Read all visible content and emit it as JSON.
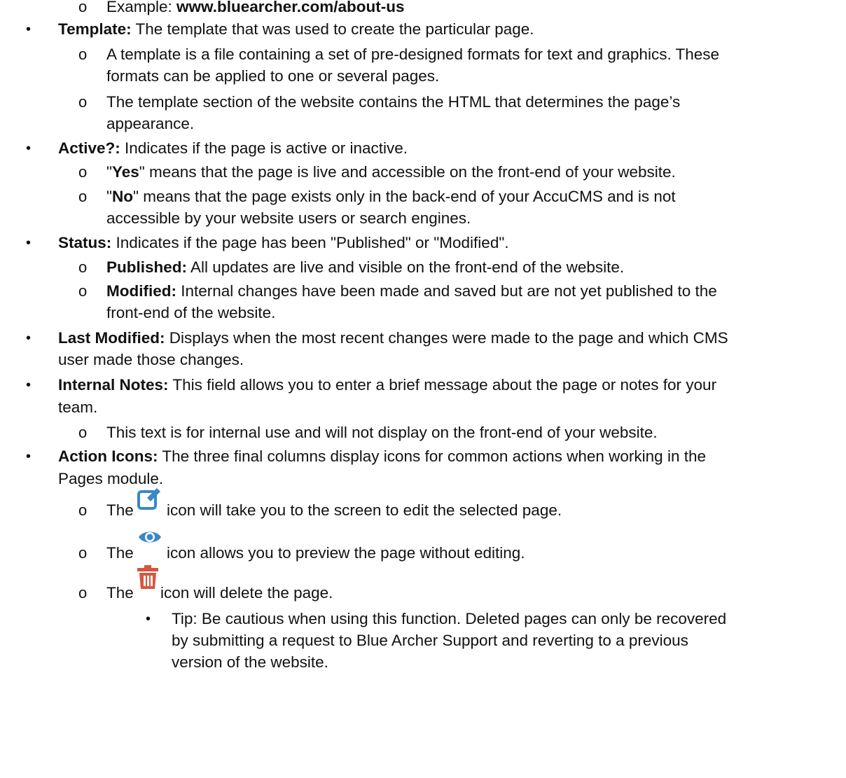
{
  "example": {
    "label": "Example: ",
    "url": "www.bluearcher.com/about-us"
  },
  "template": {
    "term": "Template:",
    "desc": " The template that was used to create the particular page.",
    "sub1_l1": "A template is a file containing a set of pre-designed formats for text and graphics. These",
    "sub1_l2": "formats can be applied to one or several pages.",
    "sub2_l1": "The template section of the website contains the HTML that determines the page’s",
    "sub2_l2": "appearance."
  },
  "active": {
    "term": "Active?:",
    "desc": " Indicates if the page is active or inactive.",
    "yes_open": "\"",
    "yes": "Yes",
    "yes_rest": "\" means that the page is live and accessible on the front-end of your website.",
    "no_open": "\"",
    "no": "No",
    "no_rest": "\" means that the page exists only in the back-end of your AccuCMS and is not",
    "no_l2": "accessible by your website users or search engines."
  },
  "status": {
    "term": "Status:",
    "desc": " Indicates if the page has been \"Published\" or \"Modified\".",
    "pub_term": "Published:",
    "pub_desc": " All updates are live and visible on the front-end of the website.",
    "mod_term": "Modified:",
    "mod_desc": " Internal changes have been made and saved but are not yet published to the",
    "mod_l2": "front-end of the website."
  },
  "last_modified": {
    "term": "Last Modified:",
    "desc": " Displays when the most recent changes were made to the page and which CMS",
    "l2": "user made those changes."
  },
  "internal_notes": {
    "term": "Internal Notes:",
    "desc": " This field allows you to enter a brief message about the page or notes for your",
    "l2": "team.",
    "sub1": "This text is for internal use and will not display on the front-end of your website."
  },
  "action_icons": {
    "term": "Action Icons:",
    "desc": " The three final columns display icons for common actions when working in the",
    "l2": "Pages module.",
    "edit_pre": "The",
    "edit_post": "icon will take you to the screen to edit the selected page.",
    "view_pre": "The",
    "view_post": "icon allows you to preview the page without editing.",
    "delete_pre": "The",
    "delete_post": "icon will delete the page.",
    "tip_l1": "Tip: Be cautious when using this function. Deleted pages can only be recovered",
    "tip_l2": "by submitting a request to Blue Archer Support and reverting to a previous",
    "tip_l3": "version of the website."
  },
  "colors": {
    "edit_icon": "#3a87c8",
    "view_icon": "#3a87c8",
    "delete_icon": "#d9543f"
  },
  "icons": [
    "edit-icon",
    "view-icon",
    "delete-icon"
  ]
}
